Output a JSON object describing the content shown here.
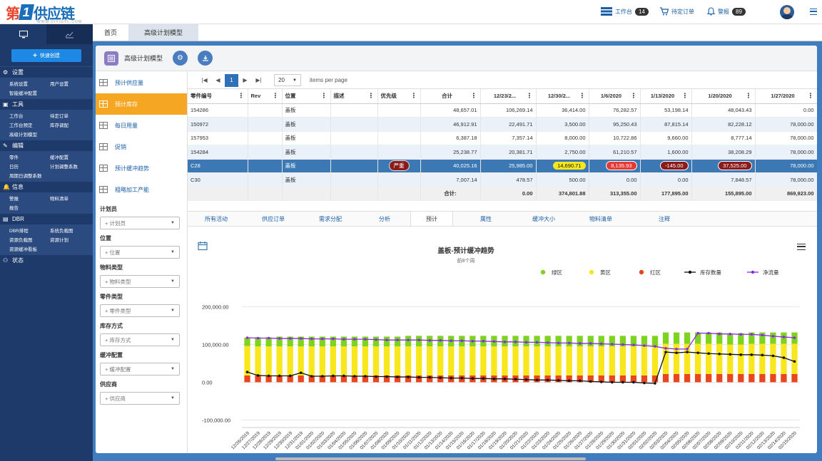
{
  "app": {
    "logo_a": "第",
    "logo_b": "1",
    "logo_c": "供应链",
    "logo_sub": "WWW.DIYIGYL.COM"
  },
  "topbar": {
    "workbench": "工作台",
    "workbench_count": "14",
    "pending": "待定订单",
    "alerts": "警报",
    "alerts_count": "89"
  },
  "sidebar": {
    "quick": "快速创建",
    "sections": [
      {
        "title": "设置",
        "icon": "gear-icon",
        "items": [
          [
            "系统设置",
            "用户设置"
          ],
          [
            "智能缓冲配置"
          ]
        ]
      },
      {
        "title": "工具",
        "icon": "toolbox-icon",
        "items": [
          [
            "工作台",
            "待定订单"
          ],
          [
            "工作台预定",
            "库存调配"
          ],
          [
            "高级计划模型"
          ]
        ]
      },
      {
        "title": "编辑",
        "icon": "edit-icon",
        "items": [
          [
            "零件",
            "缓冲配置"
          ],
          [
            "日历",
            "计划调整系数"
          ],
          [
            "周期日调整系数"
          ]
        ]
      },
      {
        "title": "信息",
        "icon": "bell-icon",
        "items": [
          [
            "警报",
            "物料清单"
          ],
          [
            "报告"
          ]
        ]
      },
      {
        "title": "DBR",
        "icon": "dbr-icon",
        "items": [
          [
            "DBR排程",
            "系统负载图"
          ],
          [
            "资源负载图",
            "资源计划"
          ],
          [
            "资源缓冲看板"
          ]
        ]
      },
      {
        "title": "状态",
        "icon": "status-icon",
        "items": []
      }
    ]
  },
  "tabs": {
    "home": "首页",
    "model": "高级计划模型"
  },
  "panel": {
    "title": "高级计划模型"
  },
  "left": {
    "menu": [
      "预计供应量",
      "预计库存",
      "每日用量",
      "促销",
      "预计缓冲趋势",
      "粗略加工产能"
    ],
    "filters": [
      {
        "label": "计划员",
        "placeholder": "+ 计划员"
      },
      {
        "label": "位置",
        "placeholder": "+ 位置"
      },
      {
        "label": "物料类型",
        "placeholder": "+ 物料类型"
      },
      {
        "label": "零件类型",
        "placeholder": "+ 零件类型"
      },
      {
        "label": "库存方式",
        "placeholder": "+ 库存方式"
      },
      {
        "label": "缓冲配置",
        "placeholder": "+ 缓冲配置"
      },
      {
        "label": "供应商",
        "placeholder": "+ 供应商"
      }
    ]
  },
  "grid": {
    "page": "1",
    "page_size": "20",
    "per_page": "items per page",
    "columns": [
      "零件编号",
      "Rev",
      "位置",
      "描述",
      "优先级",
      "合计",
      "12/23/2...",
      "12/30/2...",
      "1/6/2020",
      "1/13/2020",
      "1/20/2020",
      "1/27/2020"
    ],
    "rows": [
      [
        "154286",
        "",
        "盖板",
        "",
        "",
        "48,657.01",
        "106,269.14",
        "36,414.00",
        "76,282.57",
        "53,198.14",
        "48,043.43",
        "0.00"
      ],
      [
        "150972",
        "",
        "盖板",
        "",
        "",
        "46,912.91",
        "22,491.71",
        "3,500.00",
        "95,250.43",
        "87,815.14",
        "82,228.12",
        "78,000.00"
      ],
      [
        "157953",
        "",
        "盖板",
        "",
        "",
        "6,387.18",
        "7,357.14",
        "8,000.00",
        "10,722.86",
        "9,660.00",
        "8,777.14",
        "78,000.00"
      ],
      [
        "154284",
        "",
        "盖板",
        "",
        "",
        "25,238.77",
        "20,381.71",
        "2,750.00",
        "61,210.57",
        "1,600.00",
        "38,208.29",
        "78,000.00"
      ],
      [
        "C28",
        "",
        "盖板",
        "",
        "严重",
        "40,025.16",
        "25,985.00",
        "14,690.71",
        "8,135.93",
        "-145.00",
        "37,525.00",
        "78,000.00"
      ],
      [
        "C30",
        "",
        "盖板",
        "",
        "",
        "7,007.14",
        "478.57",
        "500.00",
        "0.00",
        "0.00",
        "7,848.57",
        "78,000.00"
      ]
    ],
    "total_label": "合计:",
    "totals": [
      "0.00",
      "374,801.88",
      "313,355.00",
      "177,895.00",
      "155,895.00",
      "869,923.00"
    ]
  },
  "bottom_tabs": [
    "所有活动",
    "供应订单",
    "需求分配",
    "分析",
    "预计",
    "属性",
    "缓冲大小",
    "物料清单",
    "注释"
  ],
  "chart_data": {
    "type": "bar",
    "title": "盖板-预计缓冲趋势",
    "subtitle": "前8个周",
    "legend": [
      "绿区",
      "黄区",
      "红区",
      "库存数量",
      "净流量"
    ],
    "legend_position": "top-right",
    "colors": {
      "green": "#7ed321",
      "yellow": "#f8e71c",
      "red": "#e8461e",
      "stock": "#111111",
      "netflow": "#8a2be2"
    },
    "y_ticks": [
      "200,000.00",
      "100,000.00",
      "0.00",
      "-100,000.00"
    ],
    "ylim": [
      -120000,
      220000
    ],
    "categories": [
      "12/26/2019",
      "12/27/2019",
      "12/28/2019",
      "12/29/2019",
      "12/30/2019",
      "12/31/2019",
      "01/01/2020",
      "01/02/2020",
      "01/03/2020",
      "01/04/2020",
      "01/05/2020",
      "01/06/2020",
      "01/07/2020",
      "01/08/2020",
      "01/09/2020",
      "01/10/2020",
      "01/11/2020",
      "01/12/2020",
      "01/13/2020",
      "01/14/2020",
      "01/15/2020",
      "01/16/2020",
      "01/17/2020",
      "01/18/2020",
      "01/19/2020",
      "01/20/2020",
      "01/21/2020",
      "01/22/2020",
      "01/23/2020",
      "01/24/2020",
      "01/25/2020",
      "01/26/2020",
      "01/27/2020",
      "01/28/2020",
      "01/29/2020",
      "01/30/2020",
      "01/31/2020",
      "02/01/2020",
      "02/02/2020",
      "02/03/2020",
      "02/04/2020",
      "02/05/2020",
      "02/06/2020",
      "02/07/2020",
      "02/08/2020",
      "02/09/2020",
      "02/10/2020",
      "02/11/2020",
      "02/12/2020",
      "02/13/2020",
      "02/14/2020",
      "02/15/2020"
    ],
    "series": [
      {
        "name": "红区",
        "values": [
          18000,
          18000,
          18000,
          18000,
          18000,
          18000,
          18000,
          18000,
          18000,
          18000,
          18000,
          18000,
          18000,
          18000,
          18000,
          18000,
          18000,
          18000,
          18000,
          18000,
          18000,
          18000,
          18000,
          18000,
          18000,
          18000,
          18000,
          18000,
          18000,
          18000,
          18000,
          18000,
          18000,
          18000,
          18000,
          18000,
          18000,
          18000,
          18000,
          22000,
          22000,
          22000,
          22000,
          22000,
          22000,
          22000,
          22000,
          22000,
          22000,
          22000,
          22000,
          22000
        ]
      },
      {
        "name": "黄区",
        "values": [
          78000,
          77000,
          77000,
          77000,
          77000,
          77000,
          77000,
          77000,
          77000,
          77000,
          77000,
          77000,
          77000,
          77000,
          77000,
          77000,
          77000,
          77000,
          77000,
          77000,
          77000,
          77000,
          77000,
          77000,
          77000,
          77000,
          77000,
          77000,
          77000,
          77000,
          77000,
          77000,
          77000,
          77000,
          77000,
          77000,
          77000,
          77000,
          77000,
          80000,
          80000,
          80000,
          80000,
          80000,
          80000,
          78000,
          78000,
          80000,
          80000,
          80000,
          80000,
          80000
        ]
      },
      {
        "name": "绿区",
        "values": [
          22000,
          24000,
          24000,
          26000,
          26000,
          26000,
          26000,
          26000,
          26000,
          26000,
          26000,
          26000,
          26000,
          26000,
          26000,
          28000,
          28000,
          28000,
          28000,
          28000,
          28000,
          28000,
          28000,
          28000,
          28000,
          28000,
          28000,
          28000,
          28000,
          28000,
          28000,
          28000,
          28000,
          28000,
          28000,
          28000,
          28000,
          28000,
          28000,
          30000,
          30000,
          30000,
          30000,
          30000,
          30000,
          28000,
          30000,
          30000,
          30000,
          30000,
          30000,
          30000
        ]
      },
      {
        "name": "库存数量",
        "values": [
          27000,
          18000,
          17000,
          17000,
          17000,
          25000,
          16000,
          16000,
          17000,
          17000,
          16000,
          16000,
          15000,
          15000,
          14000,
          14000,
          13000,
          13000,
          12000,
          11000,
          11000,
          10000,
          10000,
          9000,
          9000,
          8000,
          7000,
          6000,
          6000,
          5000,
          4000,
          4000,
          2000,
          1000,
          0,
          0,
          0,
          -2000,
          -3000,
          80000,
          78000,
          80000,
          78000,
          76000,
          75000,
          74000,
          73000,
          73000,
          72000,
          70000,
          65000,
          55000
        ]
      },
      {
        "name": "净流量",
        "values": [
          118000,
          117000,
          117000,
          116000,
          116000,
          116000,
          115000,
          115000,
          115000,
          114000,
          114000,
          114000,
          113000,
          112000,
          112000,
          112000,
          112000,
          111000,
          111000,
          110000,
          110000,
          109000,
          109000,
          108000,
          107000,
          107000,
          106000,
          106000,
          105000,
          104000,
          104000,
          103000,
          103000,
          102000,
          101000,
          100000,
          99000,
          97000,
          95000,
          90000,
          88000,
          88000,
          130000,
          130000,
          128000,
          128000,
          127000,
          127000,
          125000,
          122000,
          120000,
          118000
        ]
      }
    ]
  }
}
